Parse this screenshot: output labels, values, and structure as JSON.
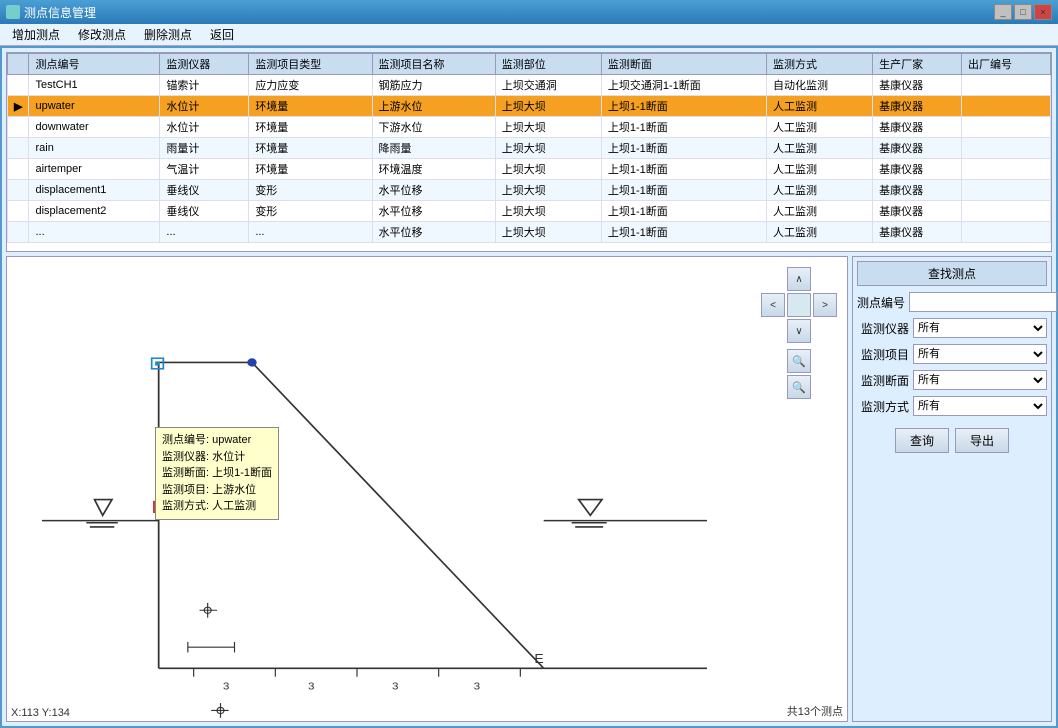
{
  "titleBar": {
    "title": "测点信息管理",
    "buttons": [
      "_",
      "□",
      "×"
    ]
  },
  "menuBar": {
    "items": [
      "增加测点",
      "修改测点",
      "删除测点",
      "返回"
    ]
  },
  "table": {
    "columns": [
      "测点编号",
      "监测仪器",
      "监测项目类型",
      "监测项目名称",
      "监测部位",
      "监测断面",
      "监测方式",
      "生产厂家",
      "出厂编号"
    ],
    "rows": [
      {
        "id": "TestCH1",
        "instrument": "锚索计",
        "type": "应力应变",
        "name": "钢筋应力",
        "location": "上坝交通洞",
        "section": "上坝交通洞1-1断面",
        "method": "自动化监测",
        "manufacturer": "基康仪器",
        "serial": "",
        "selected": false,
        "indicator": ""
      },
      {
        "id": "upwater",
        "instrument": "水位计",
        "type": "环境量",
        "name": "上游水位",
        "location": "上坝大坝",
        "section": "上坝1-1断面",
        "method": "人工监测",
        "manufacturer": "基康仪器",
        "serial": "",
        "selected": true,
        "indicator": "▶"
      },
      {
        "id": "downwater",
        "instrument": "水位计",
        "type": "环境量",
        "name": "下游水位",
        "location": "上坝大坝",
        "section": "上坝1-1断面",
        "method": "人工监测",
        "manufacturer": "基康仪器",
        "serial": "",
        "selected": false,
        "indicator": ""
      },
      {
        "id": "rain",
        "instrument": "雨量计",
        "type": "环境量",
        "name": "降雨量",
        "location": "上坝大坝",
        "section": "上坝1-1断面",
        "method": "人工监测",
        "manufacturer": "基康仪器",
        "serial": "",
        "selected": false,
        "indicator": ""
      },
      {
        "id": "airtemper",
        "instrument": "气温计",
        "type": "环境量",
        "name": "环境温度",
        "location": "上坝大坝",
        "section": "上坝1-1断面",
        "method": "人工监测",
        "manufacturer": "基康仪器",
        "serial": "",
        "selected": false,
        "indicator": ""
      },
      {
        "id": "displacement1",
        "instrument": "垂线仪",
        "type": "变形",
        "name": "水平位移",
        "location": "上坝大坝",
        "section": "上坝1-1断面",
        "method": "人工监测",
        "manufacturer": "基康仪器",
        "serial": "",
        "selected": false,
        "indicator": ""
      },
      {
        "id": "displacement2",
        "instrument": "垂线仪",
        "type": "变形",
        "name": "水平位移",
        "location": "上坝大坝",
        "section": "上坝1-1断面",
        "method": "人工监测",
        "manufacturer": "基康仪器",
        "serial": "",
        "selected": false,
        "indicator": ""
      },
      {
        "id": "...",
        "instrument": "...",
        "type": "...",
        "name": "水平位移",
        "location": "上坝大坝",
        "section": "上坝1-1断面",
        "method": "人工监测",
        "manufacturer": "基康仪器",
        "serial": "",
        "selected": false,
        "indicator": ""
      }
    ]
  },
  "navButtons": {
    "up": "∧",
    "left": "<",
    "right": ">",
    "down": "∨",
    "zoomIn": "🔍",
    "zoomOut": "🔍"
  },
  "tooltip": {
    "line1": "测点编号: upwater",
    "line2": "监测仪器: 水位计",
    "line3": "监测断面: 上坝1-1断面",
    "line4": "监测项目: 上游水位",
    "line5": "监测方式: 人工监测"
  },
  "coords": "X:113  Y:134",
  "totalCount": "共13个测点",
  "rightPanel": {
    "title": "查找测点",
    "fields": [
      {
        "label": "测点编号",
        "type": "input",
        "value": "",
        "placeholder": ""
      },
      {
        "label": "监测仪器",
        "type": "select",
        "value": "所有",
        "options": [
          "所有"
        ]
      },
      {
        "label": "监测项目",
        "type": "select",
        "value": "所有",
        "options": [
          "所有"
        ]
      },
      {
        "label": "监测断面",
        "type": "select",
        "value": "所有",
        "options": [
          "所有"
        ]
      },
      {
        "label": "监测方式",
        "type": "select",
        "value": "所有",
        "options": [
          "所有"
        ]
      }
    ],
    "buttons": [
      "查询",
      "导出"
    ]
  }
}
